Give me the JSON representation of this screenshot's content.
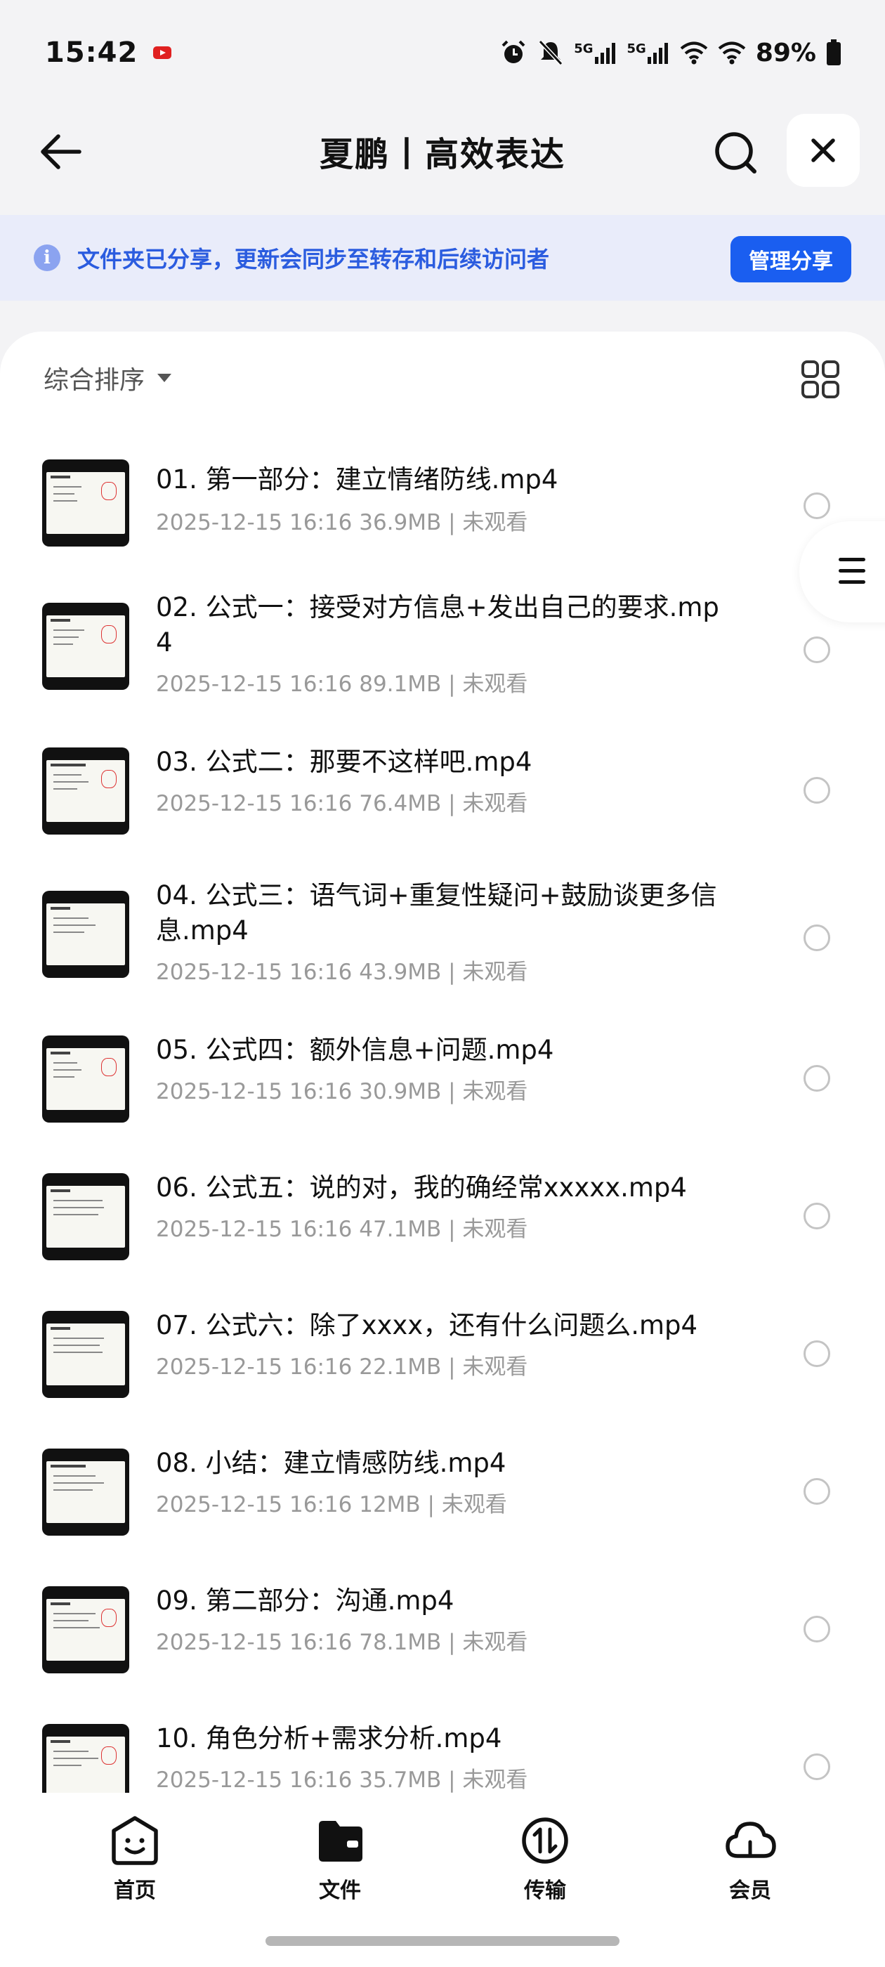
{
  "status_bar": {
    "time": "15:42",
    "network1": "5G",
    "network2": "5G",
    "battery": "89%"
  },
  "header": {
    "title": "夏鹏丨高效表达"
  },
  "notice": {
    "text": "文件夹已分享，更新会同步至转存和后续访问者",
    "button": "管理分享"
  },
  "toolbar": {
    "sort_label": "综合排序"
  },
  "files": [
    {
      "name": "01. 第一部分：建立情绪防线.mp4",
      "date": "2025-12-15 16:16",
      "size": "36.9MB",
      "status": "未观看"
    },
    {
      "name": "02. 公式一：接受对方信息+发出自己的要求.mp4",
      "date": "2025-12-15 16:16",
      "size": "89.1MB",
      "status": "未观看"
    },
    {
      "name": "03. 公式二：那要不这样吧.mp4",
      "date": "2025-12-15 16:16",
      "size": "76.4MB",
      "status": "未观看"
    },
    {
      "name": "04. 公式三：语气词+重复性疑问+鼓励谈更多信息.mp4",
      "date": "2025-12-15 16:16",
      "size": "43.9MB",
      "status": "未观看"
    },
    {
      "name": "05. 公式四：额外信息+问题.mp4",
      "date": "2025-12-15 16:16",
      "size": "30.9MB",
      "status": "未观看"
    },
    {
      "name": "06. 公式五：说的对，我的确经常xxxxx.mp4",
      "date": "2025-12-15 16:16",
      "size": "47.1MB",
      "status": "未观看"
    },
    {
      "name": "07. 公式六：除了xxxx，还有什么问题么.mp4",
      "date": "2025-12-15 16:16",
      "size": "22.1MB",
      "status": "未观看"
    },
    {
      "name": "08. 小结：建立情感防线.mp4",
      "date": "2025-12-15 16:16",
      "size": "12MB",
      "status": "未观看"
    },
    {
      "name": "09. 第二部分：沟通.mp4",
      "date": "2025-12-15 16:16",
      "size": "78.1MB",
      "status": "未观看"
    },
    {
      "name": "10. 角色分析+需求分析.mp4",
      "date": "2025-12-15 16:16",
      "size": "35.7MB",
      "status": "未观看"
    }
  ],
  "bottom_nav": [
    {
      "label": "首页",
      "icon": "smiley-icon"
    },
    {
      "label": "文件",
      "icon": "folder-icon"
    },
    {
      "label": "传输",
      "icon": "transfer-icon"
    },
    {
      "label": "会员",
      "icon": "cloud-icon"
    }
  ],
  "colors": {
    "accent": "#1a5ef0",
    "notice_bg": "#e9ecfa",
    "notice_text": "#2b5cdf"
  }
}
